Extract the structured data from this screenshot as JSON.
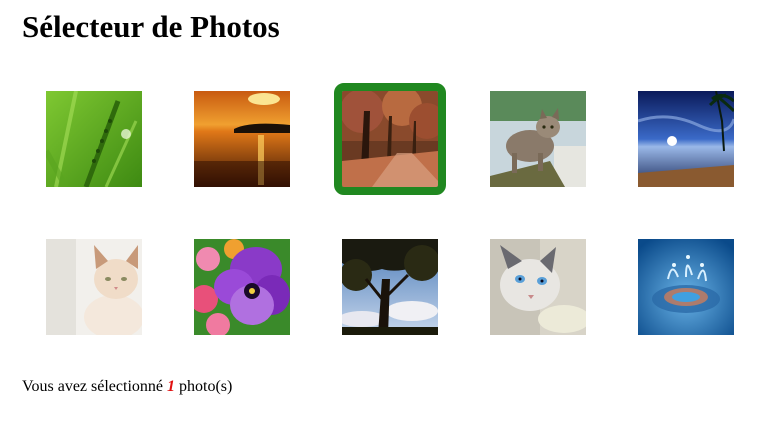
{
  "page": {
    "title": "Sélecteur de Photos"
  },
  "photos": [
    {
      "name": "photo-grass-icon",
      "subject": "grass blade",
      "selected": false
    },
    {
      "name": "photo-sunset-lake-icon",
      "subject": "sunset over water",
      "selected": false
    },
    {
      "name": "photo-autumn-trees-icon",
      "subject": "autumn tree path",
      "selected": true
    },
    {
      "name": "photo-cat-walking-icon",
      "subject": "tabby cat",
      "selected": false
    },
    {
      "name": "photo-night-beach-icon",
      "subject": "night sky beach",
      "selected": false
    },
    {
      "name": "photo-siamese-kitten-icon",
      "subject": "siamese kitten",
      "selected": false
    },
    {
      "name": "photo-pansy-flower-icon",
      "subject": "pansy flowers",
      "selected": false
    },
    {
      "name": "photo-tree-sky-icon",
      "subject": "tree against sky",
      "selected": false
    },
    {
      "name": "photo-cat-blue-eyes-icon",
      "subject": "cat with blue eyes",
      "selected": false
    },
    {
      "name": "photo-water-drop-icon",
      "subject": "water drop splash",
      "selected": false
    }
  ],
  "status": {
    "prefix": "Vous avez sélectionné ",
    "count": "1",
    "suffix": " photo(s)"
  },
  "colors": {
    "selection_border": "#208820",
    "count_color": "#e01010"
  }
}
